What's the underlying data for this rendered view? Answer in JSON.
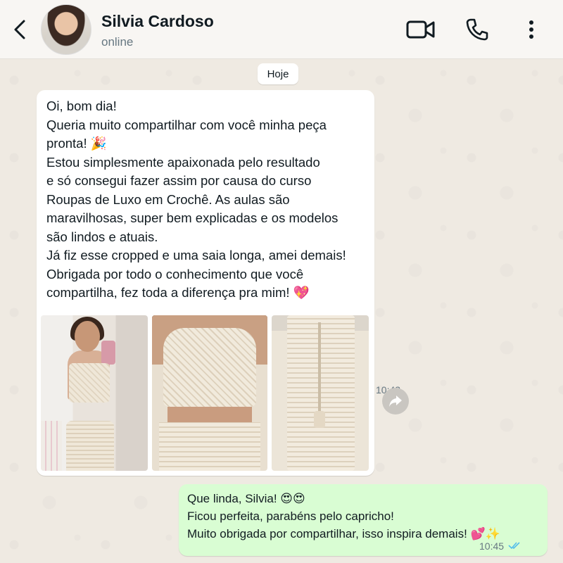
{
  "header": {
    "contact_name": "Silvia Cardoso",
    "status": "online",
    "icons": [
      "back-arrow-icon",
      "video-call-icon",
      "phone-icon",
      "more-vertical-icon"
    ]
  },
  "chat": {
    "date_chip": "Hoje",
    "incoming": {
      "lines": [
        "Oi, bom dia!",
        "Queria muito compartilhar com você minha peça",
        "pronta! 🎉",
        "Estou simplesmente apaixonada pelo resultado",
        "e só consegui fazer assim por causa do curso",
        "Roupas de Luxo em Crochê. As aulas são",
        "maravilhosas, super bem explicadas e os modelos",
        "são lindos e atuais.",
        "Já fiz esse cropped e uma saia longa, amei demais!",
        "Obrigada por todo o conhecimento que você",
        "compartilha, fez toda a diferença pra mim! 💖"
      ],
      "time": "10:42",
      "photos": [
        "mirror-selfie-crochet-outfit-photo",
        "crochet-cropped-top-photo",
        "crochet-long-skirt-photo"
      ]
    },
    "outgoing": {
      "lines": [
        "Que linda, Silvia! 😍😍",
        "Ficou perfeita, parabéns pelo capricho!",
        "Muito obrigada por compartilhar, isso inspira demais! 💕✨"
      ],
      "time": "10:45",
      "read_status": "read"
    }
  },
  "colors": {
    "chat_background": "#efeae2",
    "incoming_bubble": "#ffffff",
    "outgoing_bubble": "#d9fdd3",
    "read_ticks": "#53bdeb",
    "header_background": "#f8f6f3"
  }
}
